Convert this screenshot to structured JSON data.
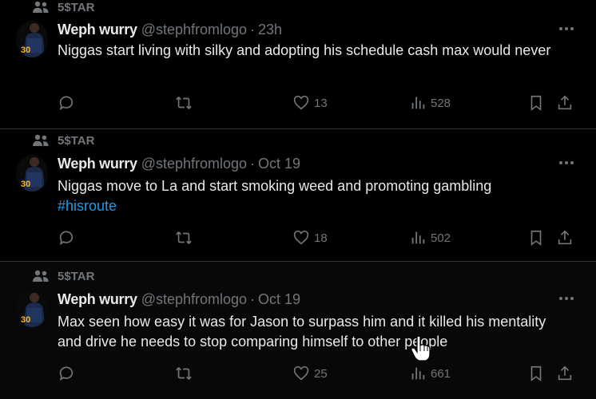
{
  "colors": {
    "background": "#000000",
    "text_primary": "#e7e9ea",
    "text_secondary": "#71767b",
    "link": "#1d9bf0",
    "divider": "#2f3336"
  },
  "icons": {
    "context": "people-icon",
    "more": "more-dots-icon",
    "reply": "reply-bubble-icon",
    "repost": "repost-arrows-icon",
    "like": "heart-icon",
    "views": "bar-chart-icon",
    "bookmark": "bookmark-icon",
    "share": "share-upload-icon"
  },
  "tweets": [
    {
      "context_label": "5$TAR",
      "author_name": "Weph wurry",
      "handle": "@stephfromlogo",
      "separator": "·",
      "time": "23h",
      "text": "Niggas start living with silky and adopting his schedule cash max would never",
      "hashtag": "",
      "likes": "13",
      "views": "528"
    },
    {
      "context_label": "5$TAR",
      "author_name": "Weph wurry",
      "handle": "@stephfromlogo",
      "separator": "·",
      "time": "Oct 19",
      "text": "Niggas move to La and start smoking weed and promoting gambling",
      "hashtag": "#hisroute",
      "likes": "18",
      "views": "502"
    },
    {
      "context_label": "5$TAR",
      "author_name": "Weph wurry",
      "handle": "@stephfromlogo",
      "separator": "·",
      "time": "Oct 19",
      "text": "Max seen how easy it was for Jason to surpass him and it killed his mentality and drive he needs to stop comparing himself to other people",
      "hashtag": "",
      "likes": "25",
      "views": "661"
    }
  ]
}
